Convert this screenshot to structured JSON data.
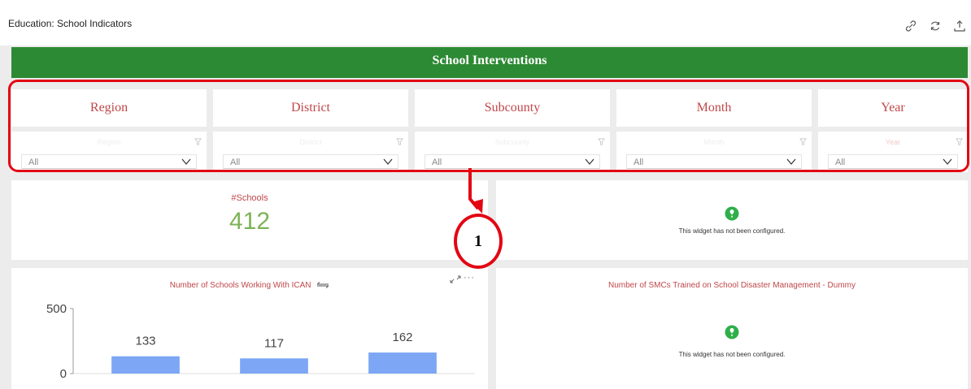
{
  "header": {
    "title": "Education: School Indicators",
    "icons": [
      "link-icon",
      "refresh-icon",
      "share-icon"
    ]
  },
  "banner": {
    "title": "School Interventions"
  },
  "filters": [
    {
      "heading": "Region",
      "ghost": "Region",
      "value": "All"
    },
    {
      "heading": "District",
      "ghost": "District",
      "value": "All"
    },
    {
      "heading": "Subcounty",
      "ghost": "Subcounty",
      "value": "All"
    },
    {
      "heading": "Month",
      "ghost": "Month",
      "value": "All"
    },
    {
      "heading": "Year",
      "ghost": "Year",
      "value": "All"
    }
  ],
  "kpi": {
    "label": "#Schools",
    "value": "412"
  },
  "widgets": {
    "top_right": {
      "message": "This widget has not been configured."
    },
    "bottom_right": {
      "title": "Number of SMCs Trained on School Disaster Management - Dummy",
      "message": "This widget has not been configured."
    }
  },
  "callout": {
    "label": "1"
  },
  "chart_data": {
    "type": "bar",
    "title": "Number of Schools Working With ICAN",
    "categories": [
      "",
      "",
      ""
    ],
    "values": [
      133,
      117,
      162
    ],
    "ylim": [
      0,
      500
    ],
    "yticks": [
      "500",
      "0"
    ],
    "bar_color": "#7da7f5",
    "grid": false
  },
  "colors": {
    "banner": "#2d8a34",
    "accent_text": "#c0474a",
    "kpi_value": "#7cb356",
    "highlight": "#e30613",
    "widget_icon": "#2eaf4a"
  }
}
